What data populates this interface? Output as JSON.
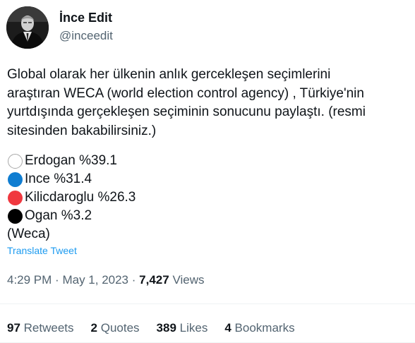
{
  "author": {
    "display_name": "İnce Edit",
    "handle": "@inceedit",
    "avatar_icon": "profile-photo-icon"
  },
  "tweet": {
    "text_lines": [
      "Global olarak her ülkenin anlık gercekleşen seçimlerini",
      "araştıran WECA (world election control agency) , Türkiye'nin",
      "yurtdışında gerçekleşen seçiminin sonucunu paylaştı. (resmi",
      "sitesinden bakabilirsiniz.)"
    ],
    "results": [
      {
        "label": "Erdogan %39.1",
        "color": "#ffffff",
        "icon": "white-circle-icon"
      },
      {
        "label": "Ince %31.4",
        "color": "#0f7dd1",
        "icon": "blue-circle-icon"
      },
      {
        "label": "Kilicdaroglu %26.3",
        "color": "#f0383f",
        "icon": "red-circle-icon"
      },
      {
        "label": "Ogan %3.2",
        "color": "#000000",
        "icon": "black-circle-icon"
      }
    ],
    "source": "(Weca)",
    "translate_label": "Translate Tweet"
  },
  "meta": {
    "time": "4:29 PM",
    "date": "May 1, 2023",
    "separator": "·",
    "views_count": "7,427",
    "views_label": "Views"
  },
  "stats": [
    {
      "count": "97",
      "label": "Retweets"
    },
    {
      "count": "2",
      "label": "Quotes"
    },
    {
      "count": "389",
      "label": "Likes"
    },
    {
      "count": "4",
      "label": "Bookmarks"
    }
  ],
  "colors": {
    "text": "#0f1419",
    "secondary": "#536471",
    "link": "#1d9bf0",
    "divider": "#eff3f4"
  }
}
